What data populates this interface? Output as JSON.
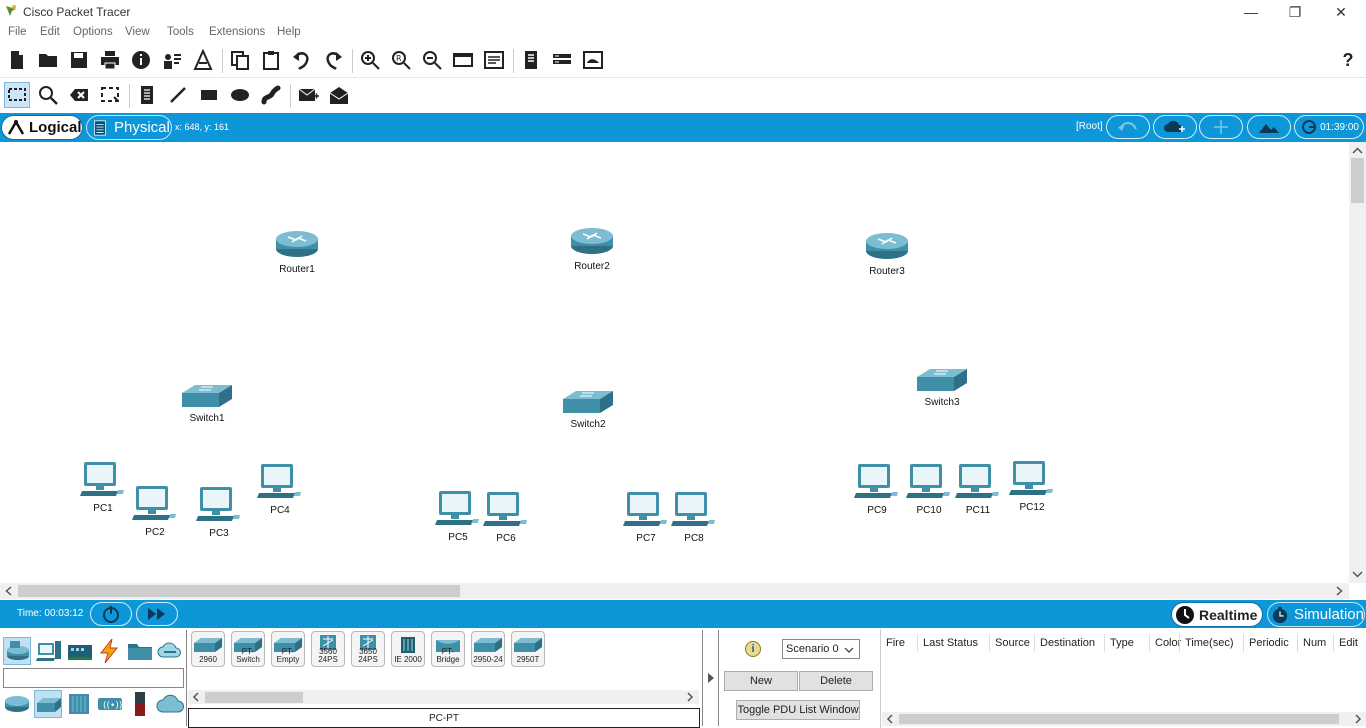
{
  "window": {
    "title": "Cisco Packet Tracer",
    "minimize_glyph": "—",
    "restore_glyph": "❐",
    "close_glyph": "✕"
  },
  "menu": [
    "File",
    "Edit",
    "Options",
    "View",
    "Tools",
    "Extensions",
    "Help"
  ],
  "toolbar": {
    "help_glyph": "?"
  },
  "workspace_bar": {
    "logical_label": "Logical",
    "physical_label": "Physical",
    "coords": "x: 648, y: 161",
    "root_label": "[Root]",
    "clock": "01:39:00"
  },
  "devices": {
    "routers": [
      "Router1",
      "Router2",
      "Router3"
    ],
    "switches": [
      "Switch1",
      "Switch2",
      "Switch3"
    ],
    "pcs": [
      "PC1",
      "PC2",
      "PC3",
      "PC4",
      "PC5",
      "PC6",
      "PC7",
      "PC8",
      "PC9",
      "PC10",
      "PC11",
      "PC12"
    ]
  },
  "sim_bar": {
    "time": "Time: 00:03:12",
    "realtime_label": "Realtime",
    "simulation_label": "Simulation"
  },
  "palette": {
    "models": [
      {
        "line1": "",
        "line2": "2960"
      },
      {
        "line1": "",
        "line2": "PT-Switch"
      },
      {
        "line1": "",
        "line2": "PT-Empty"
      },
      {
        "line1": "3560",
        "line2": "24PS"
      },
      {
        "line1": "3650",
        "line2": "24PS"
      },
      {
        "line1": "",
        "line2": "IE 2000"
      },
      {
        "line1": "",
        "line2": "PT-Bridge"
      },
      {
        "line1": "",
        "line2": "2950-24"
      },
      {
        "line1": "",
        "line2": "2950T"
      }
    ],
    "selected_model": "PC-PT"
  },
  "scenario": {
    "info_glyph": "i",
    "selected": "Scenario 0",
    "new_label": "New",
    "delete_label": "Delete",
    "toggle_label": "Toggle PDU List Window"
  },
  "pdu_table": {
    "columns": [
      "Fire",
      "Last Status",
      "Source",
      "Destination",
      "Type",
      "Color",
      "Time(sec)",
      "Periodic",
      "Num",
      "Edit"
    ]
  },
  "colors": {
    "accent_blue": "#0e97d8",
    "device_teal": "#3f8fa8"
  }
}
